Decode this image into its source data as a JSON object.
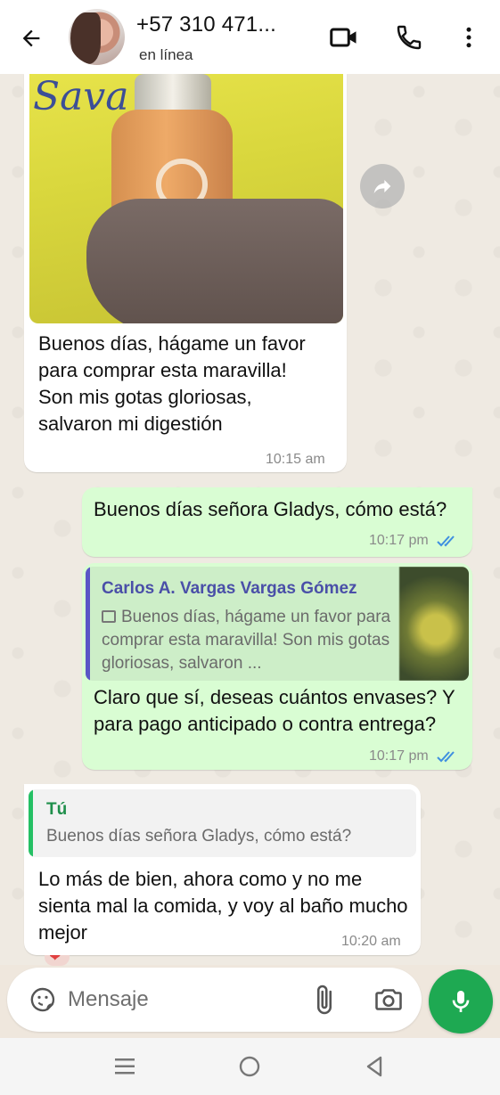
{
  "header": {
    "contact_name": "+57 310 471...",
    "status": "en línea"
  },
  "messages": [
    {
      "direction": "incoming",
      "type": "image",
      "photo_scribble": "Sava",
      "caption": "Buenos días, hágame un favor para comprar esta maravilla! Son mis gotas gloriosas, salvaron mi digestión",
      "time": "10:15 am"
    },
    {
      "direction": "outgoing",
      "text": "Buenos días señora Gladys, cómo está?",
      "time": "10:17 pm",
      "read": true
    },
    {
      "direction": "outgoing",
      "quoted_author": "Carlos A. Vargas Vargas Gómez",
      "quoted_text": "Buenos días, hágame un favor para comprar esta maravilla! Son mis gotas gloriosas, salvaron ...",
      "text": "Claro que sí, deseas cuántos envases? Y para pago anticipado o contra entrega?",
      "time": "10:17 pm",
      "read": true
    },
    {
      "direction": "incoming",
      "quoted_author": "Tú",
      "quoted_text": "Buenos días señora Gladys, cómo está?",
      "text": "Lo más de bien, ahora como y no me sienta mal la comida, y voy al baño mucho mejor",
      "time": "10:20 am"
    }
  ],
  "composer": {
    "placeholder": "Mensaje"
  },
  "colors": {
    "header_bg": "#ffffff",
    "chat_bg": "#efeae2",
    "incoming_bubble": "#ffffff",
    "outgoing_bubble": "#d9fdd3",
    "read_ticks": "#3f8fe0",
    "mic_button": "#1ea952",
    "quote_bar_contact": "#5a55c6",
    "quote_bar_self": "#25c064"
  },
  "icons": {
    "back": "arrow-left-icon",
    "video": "video-call-icon",
    "phone": "phone-icon",
    "more": "more-vertical-icon",
    "forward": "forward-icon",
    "sticker": "sticker-icon",
    "attach": "paperclip-icon",
    "camera": "camera-icon",
    "mic": "microphone-icon"
  }
}
